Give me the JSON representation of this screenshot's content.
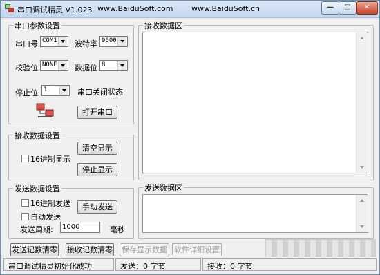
{
  "window": {
    "app_name": "串口调试精灵 V1.023",
    "site1": "www.BaiduSoft.com",
    "site2": "www.BaiduSoft.cn",
    "minimize_icon": "minimize-icon",
    "maximize_icon": "maximize-icon",
    "close_icon": "close-icon"
  },
  "serial_params": {
    "group_title": "串口参数设置",
    "port_label": "串口号",
    "port_value": "COM1",
    "baud_label": "波特率",
    "baud_value": "9600",
    "parity_label": "校验位",
    "parity_value": "NONE",
    "databits_label": "数据位",
    "databits_value": "8",
    "stopbits_label": "停止位",
    "stopbits_value": "1",
    "port_status": "串口关闭状态",
    "open_button": "打开串口"
  },
  "receive_settings": {
    "group_title": "接收数据设置",
    "hex_display_label": "16进制显示",
    "clear_button": "清空显示",
    "stop_button": "停止显示"
  },
  "send_settings": {
    "group_title": "发送数据设置",
    "hex_send_label": "16进制发送",
    "auto_send_label": "自动发送",
    "manual_send_button": "手动发送",
    "period_label": "发送周期:",
    "period_value": "1000",
    "period_unit": "毫秒"
  },
  "receive_area": {
    "title": "接收数据区"
  },
  "send_area": {
    "title": "发送数据区"
  },
  "bottom_buttons": {
    "save_send_log": "发送记数清零",
    "save_recv_log": "接收记数清零",
    "save_display": "保存显示数据",
    "software_details": "软件详细设置"
  },
  "status": {
    "message": "串口调试精灵初始化成功",
    "sent": "发送：0 字节",
    "received": "接收：0 字节"
  },
  "colors": {
    "title_bar": "#c8dcf2",
    "close_button": "#c7432b",
    "window_bg": "#f0f0f0"
  }
}
